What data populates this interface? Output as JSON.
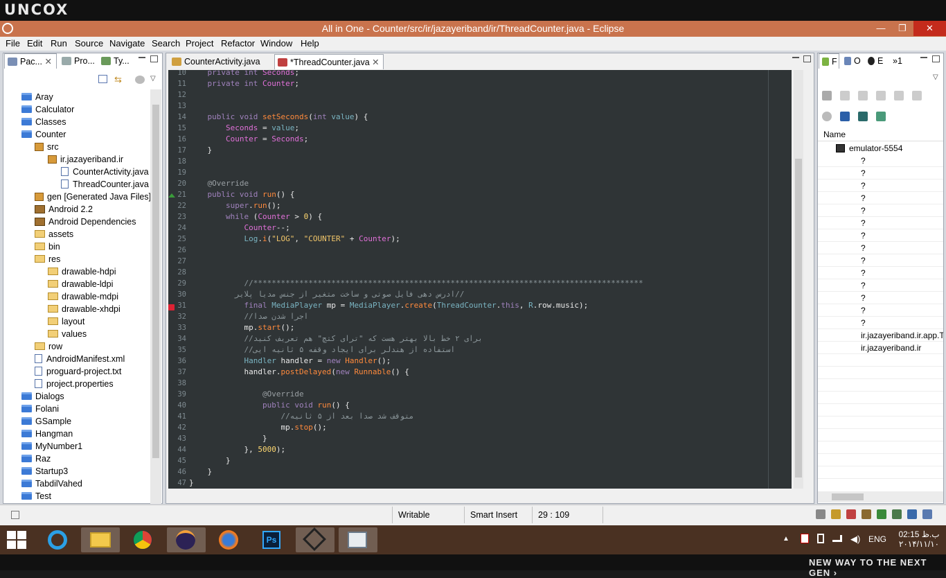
{
  "brand": "UNCOX",
  "window": {
    "title": "All in One - Counter/src/ir/jazayeriband/ir/ThreadCounter.java - Eclipse",
    "minimize": "—",
    "restore": "❐",
    "close": "✕"
  },
  "menu": [
    "File",
    "Edit",
    "Run",
    "Source",
    "Navigate",
    "Search",
    "Project",
    "Refactor",
    "Window",
    "Help"
  ],
  "left_tabs": [
    "Pac...",
    "Pro...",
    "Ty..."
  ],
  "tree": [
    {
      "label": "Aray",
      "indent": 0,
      "icon": "folder"
    },
    {
      "label": "Calculator",
      "indent": 0,
      "icon": "folder"
    },
    {
      "label": "Classes",
      "indent": 0,
      "icon": "folder"
    },
    {
      "label": "Counter",
      "indent": 0,
      "icon": "folder"
    },
    {
      "label": "src",
      "indent": 1,
      "icon": "package"
    },
    {
      "label": "ir.jazayeriband.ir",
      "indent": 2,
      "icon": "package"
    },
    {
      "label": "CounterActivity.java",
      "indent": 3,
      "icon": "file"
    },
    {
      "label": "ThreadCounter.java",
      "indent": 3,
      "icon": "file"
    },
    {
      "label": "gen [Generated Java Files]",
      "indent": 1,
      "icon": "package"
    },
    {
      "label": "Android 2.2",
      "indent": 1,
      "icon": "lib"
    },
    {
      "label": "Android Dependencies",
      "indent": 1,
      "icon": "lib"
    },
    {
      "label": "assets",
      "indent": 1,
      "icon": "openfolder"
    },
    {
      "label": "bin",
      "indent": 1,
      "icon": "openfolder"
    },
    {
      "label": "res",
      "indent": 1,
      "icon": "openfolder"
    },
    {
      "label": "drawable-hdpi",
      "indent": 2,
      "icon": "openfolder"
    },
    {
      "label": "drawable-ldpi",
      "indent": 2,
      "icon": "openfolder"
    },
    {
      "label": "drawable-mdpi",
      "indent": 2,
      "icon": "openfolder"
    },
    {
      "label": "drawable-xhdpi",
      "indent": 2,
      "icon": "openfolder"
    },
    {
      "label": "layout",
      "indent": 2,
      "icon": "openfolder"
    },
    {
      "label": "values",
      "indent": 2,
      "icon": "openfolder"
    },
    {
      "label": "row",
      "indent": 1,
      "icon": "openfolder"
    },
    {
      "label": "AndroidManifest.xml",
      "indent": 1,
      "icon": "file"
    },
    {
      "label": "proguard-project.txt",
      "indent": 1,
      "icon": "file"
    },
    {
      "label": "project.properties",
      "indent": 1,
      "icon": "file"
    },
    {
      "label": "Dialogs",
      "indent": 0,
      "icon": "folder"
    },
    {
      "label": "Folani",
      "indent": 0,
      "icon": "folder"
    },
    {
      "label": "GSample",
      "indent": 0,
      "icon": "folder"
    },
    {
      "label": "Hangman",
      "indent": 0,
      "icon": "folder"
    },
    {
      "label": "MyNumber1",
      "indent": 0,
      "icon": "folder"
    },
    {
      "label": "Raz",
      "indent": 0,
      "icon": "folder"
    },
    {
      "label": "Startup3",
      "indent": 0,
      "icon": "folder"
    },
    {
      "label": "TabdilVahed",
      "indent": 0,
      "icon": "folder"
    },
    {
      "label": "Test",
      "indent": 0,
      "icon": "folder"
    }
  ],
  "editor_tabs": [
    "CounterActivity.java",
    "*ThreadCounter.java"
  ],
  "code_lines": [
    {
      "n": "10",
      "h": "    <span class='k'>private</span> <span class='k'>int</span> <span class='v'>Seconds</span>;"
    },
    {
      "n": "11",
      "h": "    <span class='k'>private</span> <span class='k'>int</span> <span class='v'>Counter</span>;"
    },
    {
      "n": "12",
      "h": ""
    },
    {
      "n": "13",
      "h": ""
    },
    {
      "n": "14",
      "h": "    <span class='k'>public</span> <span class='k'>void</span> <span class='f'>setSeconds</span>(<span class='k'>int</span> <span class='t'>value</span>) {"
    },
    {
      "n": "15",
      "h": "        <span class='v'>Seconds</span> = <span class='t'>value</span>;"
    },
    {
      "n": "16",
      "h": "        <span class='v'>Counter</span> = <span class='v'>Seconds</span>;"
    },
    {
      "n": "17",
      "h": "    }"
    },
    {
      "n": "18",
      "h": ""
    },
    {
      "n": "19",
      "h": ""
    },
    {
      "n": "20",
      "h": "    <span class='an'>@Override</span>"
    },
    {
      "n": "21",
      "h": "    <span class='k'>public</span> <span class='k'>void</span> <span class='f'>run</span>() {"
    },
    {
      "n": "22",
      "h": "        <span class='k'>super</span>.<span class='f'>run</span>();"
    },
    {
      "n": "23",
      "h": "        <span class='k'>while</span> (<span class='v'>Counter</span> &gt; <span class='n'>0</span>) {"
    },
    {
      "n": "24",
      "h": "            <span class='v'>Counter</span>--;"
    },
    {
      "n": "25",
      "h": "            <span class='t'>Log</span>.<span class='f'>i</span>(<span class='s'>\"LOG\"</span>, <span class='s'>\"COUNTER\"</span> + <span class='v'>Counter</span>);"
    },
    {
      "n": "26",
      "h": ""
    },
    {
      "n": "27",
      "h": ""
    },
    {
      "n": "28",
      "h": ""
    },
    {
      "n": "29",
      "h": "            <span class='c'>//*************************************************************************************</span>"
    },
    {
      "n": "30",
      "h": "          <span class='c'>ادرس دهی فایل صوتی و ساخت متغیر از جنس مدیا پلایر//</span>"
    },
    {
      "n": "31",
      "h": "            <span class='k'>final</span> <span class='t'>MediaPlayer</span> mp = <span class='t'>MediaPlayer</span>.<span class='f'>create</span>(<span class='t'>ThreadCounter</span>.<span class='k'>this</span>, <span class='t'>R</span>.row.music);"
    },
    {
      "n": "32",
      "h": "            <span class='c'>//اجرا شدن صدا</span>"
    },
    {
      "n": "33",
      "h": "            mp.<span class='f'>start</span>();"
    },
    {
      "n": "34",
      "h": "            <span class='c'>//برای ۲ خط بالا بهتر هست که \"ترای کتچ\" هم تعریف کنید</span>"
    },
    {
      "n": "35",
      "h": "            <span class='c'>//استفاده از هندلر برای ایجاد وقفه ۵ ثانیه ایی</span>"
    },
    {
      "n": "36",
      "h": "            <span class='t'>Handler</span> handler = <span class='k'>new</span> <span class='f'>Handler</span>();"
    },
    {
      "n": "37",
      "h": "            handler.<span class='f'>postDelayed</span>(<span class='k'>new</span> <span class='f'>Runnable</span>() {"
    },
    {
      "n": "38",
      "h": ""
    },
    {
      "n": "39",
      "h": "                <span class='an'>@Override</span>"
    },
    {
      "n": "40",
      "h": "                <span class='k'>public</span> <span class='k'>void</span> <span class='f'>run</span>() {"
    },
    {
      "n": "41",
      "h": "                    <span class='c'>//متوقف شد صدا بعد از ۵ ثانیه</span>"
    },
    {
      "n": "42",
      "h": "                    mp.<span class='f'>stop</span>();"
    },
    {
      "n": "43",
      "h": "                }"
    },
    {
      "n": "44",
      "h": "            }, <span class='n'>5000</span>);"
    },
    {
      "n": "45",
      "h": "        }"
    },
    {
      "n": "46",
      "h": "    }"
    },
    {
      "n": "47",
      "h": "}"
    }
  ],
  "right_tabs": [
    "F",
    "O",
    "E",
    "»1"
  ],
  "devices": {
    "header": "Name",
    "emulator": "emulator-5554",
    "rows": [
      "?",
      "?",
      "?",
      "?",
      "?",
      "?",
      "?",
      "?",
      "?",
      "?",
      "?",
      "?",
      "?",
      "?",
      "ir.jazayeriband.ir.app.T",
      "ir.jazayeriband.ir"
    ]
  },
  "status": {
    "writable": "Writable",
    "insert": "Smart Insert",
    "position": "29 : 109"
  },
  "tray": {
    "lang": "ENG",
    "time": "02:15 ب.ظ",
    "date": "۲۰۱۴/۱۱/۱۰"
  },
  "slogan": "NEW WAY TO THE NEXT GEN ›"
}
